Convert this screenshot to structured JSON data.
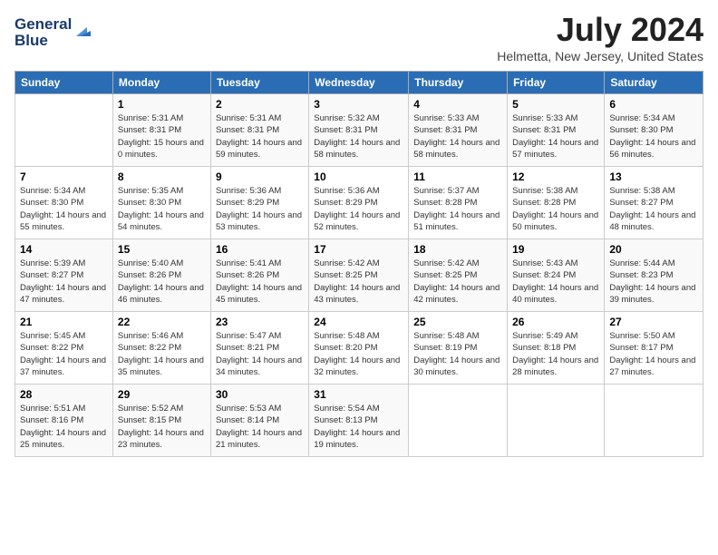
{
  "logo": {
    "line1": "General",
    "line2": "Blue"
  },
  "title": "July 2024",
  "subtitle": "Helmetta, New Jersey, United States",
  "headers": [
    "Sunday",
    "Monday",
    "Tuesday",
    "Wednesday",
    "Thursday",
    "Friday",
    "Saturday"
  ],
  "weeks": [
    [
      {
        "day": "",
        "sunrise": "",
        "sunset": "",
        "daylight": ""
      },
      {
        "day": "1",
        "sunrise": "Sunrise: 5:31 AM",
        "sunset": "Sunset: 8:31 PM",
        "daylight": "Daylight: 15 hours and 0 minutes."
      },
      {
        "day": "2",
        "sunrise": "Sunrise: 5:31 AM",
        "sunset": "Sunset: 8:31 PM",
        "daylight": "Daylight: 14 hours and 59 minutes."
      },
      {
        "day": "3",
        "sunrise": "Sunrise: 5:32 AM",
        "sunset": "Sunset: 8:31 PM",
        "daylight": "Daylight: 14 hours and 58 minutes."
      },
      {
        "day": "4",
        "sunrise": "Sunrise: 5:33 AM",
        "sunset": "Sunset: 8:31 PM",
        "daylight": "Daylight: 14 hours and 58 minutes."
      },
      {
        "day": "5",
        "sunrise": "Sunrise: 5:33 AM",
        "sunset": "Sunset: 8:31 PM",
        "daylight": "Daylight: 14 hours and 57 minutes."
      },
      {
        "day": "6",
        "sunrise": "Sunrise: 5:34 AM",
        "sunset": "Sunset: 8:30 PM",
        "daylight": "Daylight: 14 hours and 56 minutes."
      }
    ],
    [
      {
        "day": "7",
        "sunrise": "Sunrise: 5:34 AM",
        "sunset": "Sunset: 8:30 PM",
        "daylight": "Daylight: 14 hours and 55 minutes."
      },
      {
        "day": "8",
        "sunrise": "Sunrise: 5:35 AM",
        "sunset": "Sunset: 8:30 PM",
        "daylight": "Daylight: 14 hours and 54 minutes."
      },
      {
        "day": "9",
        "sunrise": "Sunrise: 5:36 AM",
        "sunset": "Sunset: 8:29 PM",
        "daylight": "Daylight: 14 hours and 53 minutes."
      },
      {
        "day": "10",
        "sunrise": "Sunrise: 5:36 AM",
        "sunset": "Sunset: 8:29 PM",
        "daylight": "Daylight: 14 hours and 52 minutes."
      },
      {
        "day": "11",
        "sunrise": "Sunrise: 5:37 AM",
        "sunset": "Sunset: 8:28 PM",
        "daylight": "Daylight: 14 hours and 51 minutes."
      },
      {
        "day": "12",
        "sunrise": "Sunrise: 5:38 AM",
        "sunset": "Sunset: 8:28 PM",
        "daylight": "Daylight: 14 hours and 50 minutes."
      },
      {
        "day": "13",
        "sunrise": "Sunrise: 5:38 AM",
        "sunset": "Sunset: 8:27 PM",
        "daylight": "Daylight: 14 hours and 48 minutes."
      }
    ],
    [
      {
        "day": "14",
        "sunrise": "Sunrise: 5:39 AM",
        "sunset": "Sunset: 8:27 PM",
        "daylight": "Daylight: 14 hours and 47 minutes."
      },
      {
        "day": "15",
        "sunrise": "Sunrise: 5:40 AM",
        "sunset": "Sunset: 8:26 PM",
        "daylight": "Daylight: 14 hours and 46 minutes."
      },
      {
        "day": "16",
        "sunrise": "Sunrise: 5:41 AM",
        "sunset": "Sunset: 8:26 PM",
        "daylight": "Daylight: 14 hours and 45 minutes."
      },
      {
        "day": "17",
        "sunrise": "Sunrise: 5:42 AM",
        "sunset": "Sunset: 8:25 PM",
        "daylight": "Daylight: 14 hours and 43 minutes."
      },
      {
        "day": "18",
        "sunrise": "Sunrise: 5:42 AM",
        "sunset": "Sunset: 8:25 PM",
        "daylight": "Daylight: 14 hours and 42 minutes."
      },
      {
        "day": "19",
        "sunrise": "Sunrise: 5:43 AM",
        "sunset": "Sunset: 8:24 PM",
        "daylight": "Daylight: 14 hours and 40 minutes."
      },
      {
        "day": "20",
        "sunrise": "Sunrise: 5:44 AM",
        "sunset": "Sunset: 8:23 PM",
        "daylight": "Daylight: 14 hours and 39 minutes."
      }
    ],
    [
      {
        "day": "21",
        "sunrise": "Sunrise: 5:45 AM",
        "sunset": "Sunset: 8:22 PM",
        "daylight": "Daylight: 14 hours and 37 minutes."
      },
      {
        "day": "22",
        "sunrise": "Sunrise: 5:46 AM",
        "sunset": "Sunset: 8:22 PM",
        "daylight": "Daylight: 14 hours and 35 minutes."
      },
      {
        "day": "23",
        "sunrise": "Sunrise: 5:47 AM",
        "sunset": "Sunset: 8:21 PM",
        "daylight": "Daylight: 14 hours and 34 minutes."
      },
      {
        "day": "24",
        "sunrise": "Sunrise: 5:48 AM",
        "sunset": "Sunset: 8:20 PM",
        "daylight": "Daylight: 14 hours and 32 minutes."
      },
      {
        "day": "25",
        "sunrise": "Sunrise: 5:48 AM",
        "sunset": "Sunset: 8:19 PM",
        "daylight": "Daylight: 14 hours and 30 minutes."
      },
      {
        "day": "26",
        "sunrise": "Sunrise: 5:49 AM",
        "sunset": "Sunset: 8:18 PM",
        "daylight": "Daylight: 14 hours and 28 minutes."
      },
      {
        "day": "27",
        "sunrise": "Sunrise: 5:50 AM",
        "sunset": "Sunset: 8:17 PM",
        "daylight": "Daylight: 14 hours and 27 minutes."
      }
    ],
    [
      {
        "day": "28",
        "sunrise": "Sunrise: 5:51 AM",
        "sunset": "Sunset: 8:16 PM",
        "daylight": "Daylight: 14 hours and 25 minutes."
      },
      {
        "day": "29",
        "sunrise": "Sunrise: 5:52 AM",
        "sunset": "Sunset: 8:15 PM",
        "daylight": "Daylight: 14 hours and 23 minutes."
      },
      {
        "day": "30",
        "sunrise": "Sunrise: 5:53 AM",
        "sunset": "Sunset: 8:14 PM",
        "daylight": "Daylight: 14 hours and 21 minutes."
      },
      {
        "day": "31",
        "sunrise": "Sunrise: 5:54 AM",
        "sunset": "Sunset: 8:13 PM",
        "daylight": "Daylight: 14 hours and 19 minutes."
      },
      {
        "day": "",
        "sunrise": "",
        "sunset": "",
        "daylight": ""
      },
      {
        "day": "",
        "sunrise": "",
        "sunset": "",
        "daylight": ""
      },
      {
        "day": "",
        "sunrise": "",
        "sunset": "",
        "daylight": ""
      }
    ]
  ]
}
